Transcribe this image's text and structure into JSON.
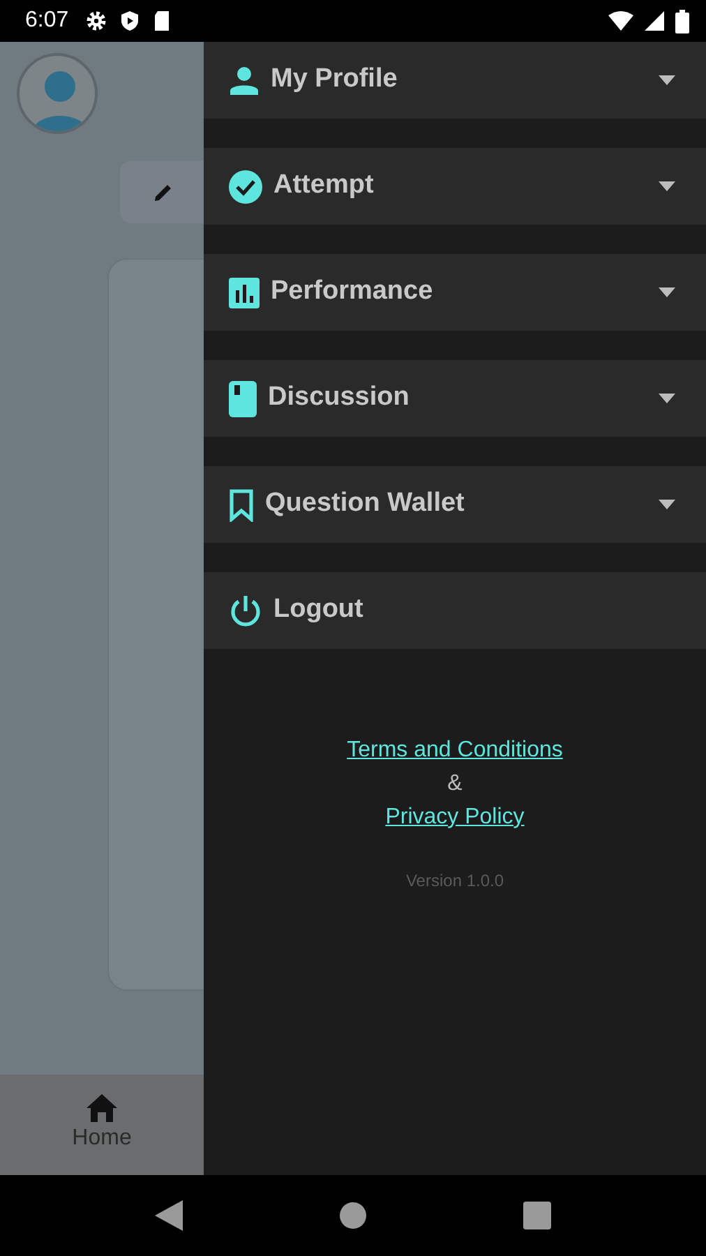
{
  "status_bar": {
    "time": "6:07"
  },
  "background": {
    "bottom_nav": [
      {
        "label": "Home",
        "selected": true
      }
    ]
  },
  "drawer": {
    "items": [
      {
        "label": "My Profile",
        "expandable": true
      },
      {
        "label": "Attempt",
        "expandable": true
      },
      {
        "label": "Performance",
        "expandable": true
      },
      {
        "label": "Discussion",
        "expandable": true
      },
      {
        "label": "Question Wallet",
        "expandable": true
      },
      {
        "label": "Logout",
        "expandable": false
      }
    ],
    "footer": {
      "terms_link": "Terms and Conditions",
      "separator": "&",
      "privacy_link": "Privacy Policy",
      "version": "Version 1.0.0"
    }
  }
}
